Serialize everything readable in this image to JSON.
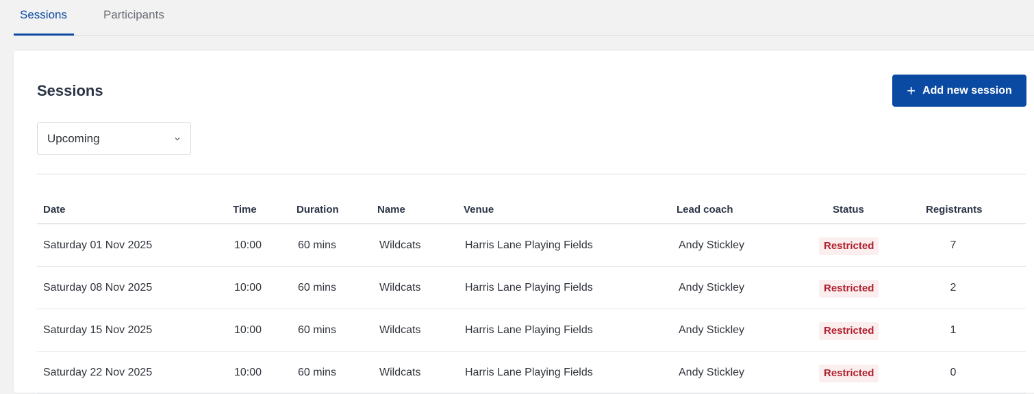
{
  "tabs": [
    {
      "label": "Sessions",
      "active": true
    },
    {
      "label": "Participants",
      "active": false
    }
  ],
  "page": {
    "title": "Sessions",
    "add_button_label": "Add new session",
    "add_button_icon": "plus-icon"
  },
  "filter": {
    "selected": "Upcoming",
    "icon": "chevron-down-icon"
  },
  "table": {
    "columns": [
      "Date",
      "Time",
      "Duration",
      "Name",
      "Venue",
      "Lead coach",
      "Status",
      "Registrants"
    ],
    "rows": [
      {
        "date": "Saturday 01 Nov 2025",
        "time": "10:00",
        "duration": "60 mins",
        "name": "Wildcats",
        "venue": "Harris Lane Playing Fields",
        "coach": "Andy Stickley",
        "status": "Restricted",
        "registrants": "7"
      },
      {
        "date": "Saturday 08 Nov 2025",
        "time": "10:00",
        "duration": "60 mins",
        "name": "Wildcats",
        "venue": "Harris Lane Playing Fields",
        "coach": "Andy Stickley",
        "status": "Restricted",
        "registrants": "2"
      },
      {
        "date": "Saturday 15 Nov 2025",
        "time": "10:00",
        "duration": "60 mins",
        "name": "Wildcats",
        "venue": "Harris Lane Playing Fields",
        "coach": "Andy Stickley",
        "status": "Restricted",
        "registrants": "1"
      },
      {
        "date": "Saturday 22 Nov 2025",
        "time": "10:00",
        "duration": "60 mins",
        "name": "Wildcats",
        "venue": "Harris Lane Playing Fields",
        "coach": "Andy Stickley",
        "status": "Restricted",
        "registrants": "0"
      }
    ]
  },
  "colors": {
    "accent": "#0b4aa2",
    "status_restricted": "#b0202f",
    "status_restricted_bg": "#fbeeee"
  }
}
